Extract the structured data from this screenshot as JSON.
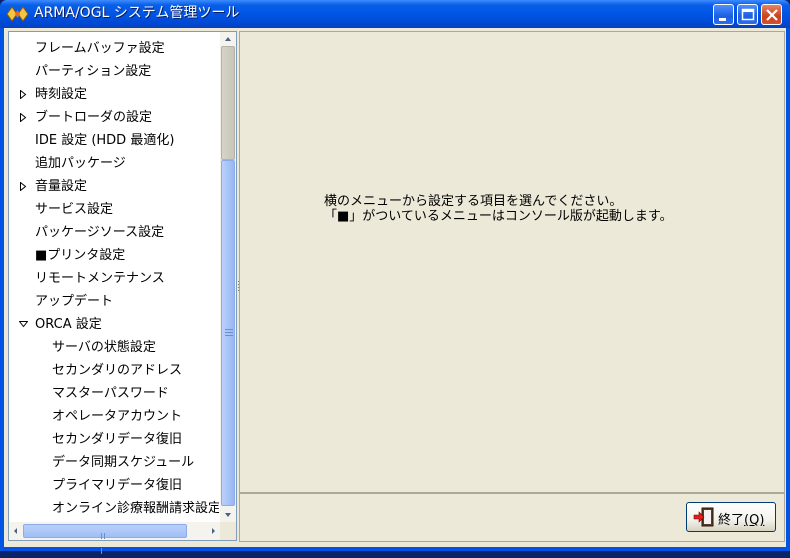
{
  "window": {
    "title": "ARMA/OGL システム管理ツール",
    "buttons": [
      "minimize",
      "maximize",
      "close"
    ]
  },
  "tree": {
    "items": [
      {
        "label": "フレームバッファ設定",
        "level": 0,
        "expander": "none"
      },
      {
        "label": "パーティション設定",
        "level": 0,
        "expander": "none"
      },
      {
        "label": "時刻設定",
        "level": 0,
        "expander": "collapsed"
      },
      {
        "label": "ブートローダの設定",
        "level": 0,
        "expander": "collapsed"
      },
      {
        "label": "IDE 設定 (HDD 最適化)",
        "level": 0,
        "expander": "none"
      },
      {
        "label": "追加パッケージ",
        "level": 0,
        "expander": "none"
      },
      {
        "label": "音量設定",
        "level": 0,
        "expander": "collapsed"
      },
      {
        "label": "サービス設定",
        "level": 0,
        "expander": "none"
      },
      {
        "label": "パッケージソース設定",
        "level": 0,
        "expander": "none"
      },
      {
        "label": "■プリンタ設定",
        "level": 0,
        "expander": "none"
      },
      {
        "label": "リモートメンテナンス",
        "level": 0,
        "expander": "none"
      },
      {
        "label": "アップデート",
        "level": 0,
        "expander": "none"
      },
      {
        "label": "ORCA 設定",
        "level": 0,
        "expander": "expanded"
      },
      {
        "label": "サーバの状態設定",
        "level": 1,
        "expander": "none"
      },
      {
        "label": "セカンダリのアドレス",
        "level": 1,
        "expander": "none"
      },
      {
        "label": "マスターパスワード",
        "level": 1,
        "expander": "none"
      },
      {
        "label": "オペレータアカウント",
        "level": 1,
        "expander": "none"
      },
      {
        "label": "セカンダリデータ復旧",
        "level": 1,
        "expander": "none"
      },
      {
        "label": "データ同期スケジュール",
        "level": 1,
        "expander": "none"
      },
      {
        "label": "プライマリデータ復旧",
        "level": 1,
        "expander": "none"
      },
      {
        "label": "オンライン診療報酬請求設定",
        "level": 1,
        "expander": "none"
      }
    ]
  },
  "main": {
    "message_line1": "横のメニューから設定する項目を選んでください。",
    "message_line2": "「■」がついているメニューはコンソール版が起動します。"
  },
  "footer": {
    "exit_label": "終了",
    "exit_mnemonic": "(Q)"
  },
  "colors": {
    "titlebar": "#0054e3",
    "client_bg": "#ece9d8",
    "tree_bg": "#ffffff",
    "scroll_thumb": "#a8c4f7"
  }
}
